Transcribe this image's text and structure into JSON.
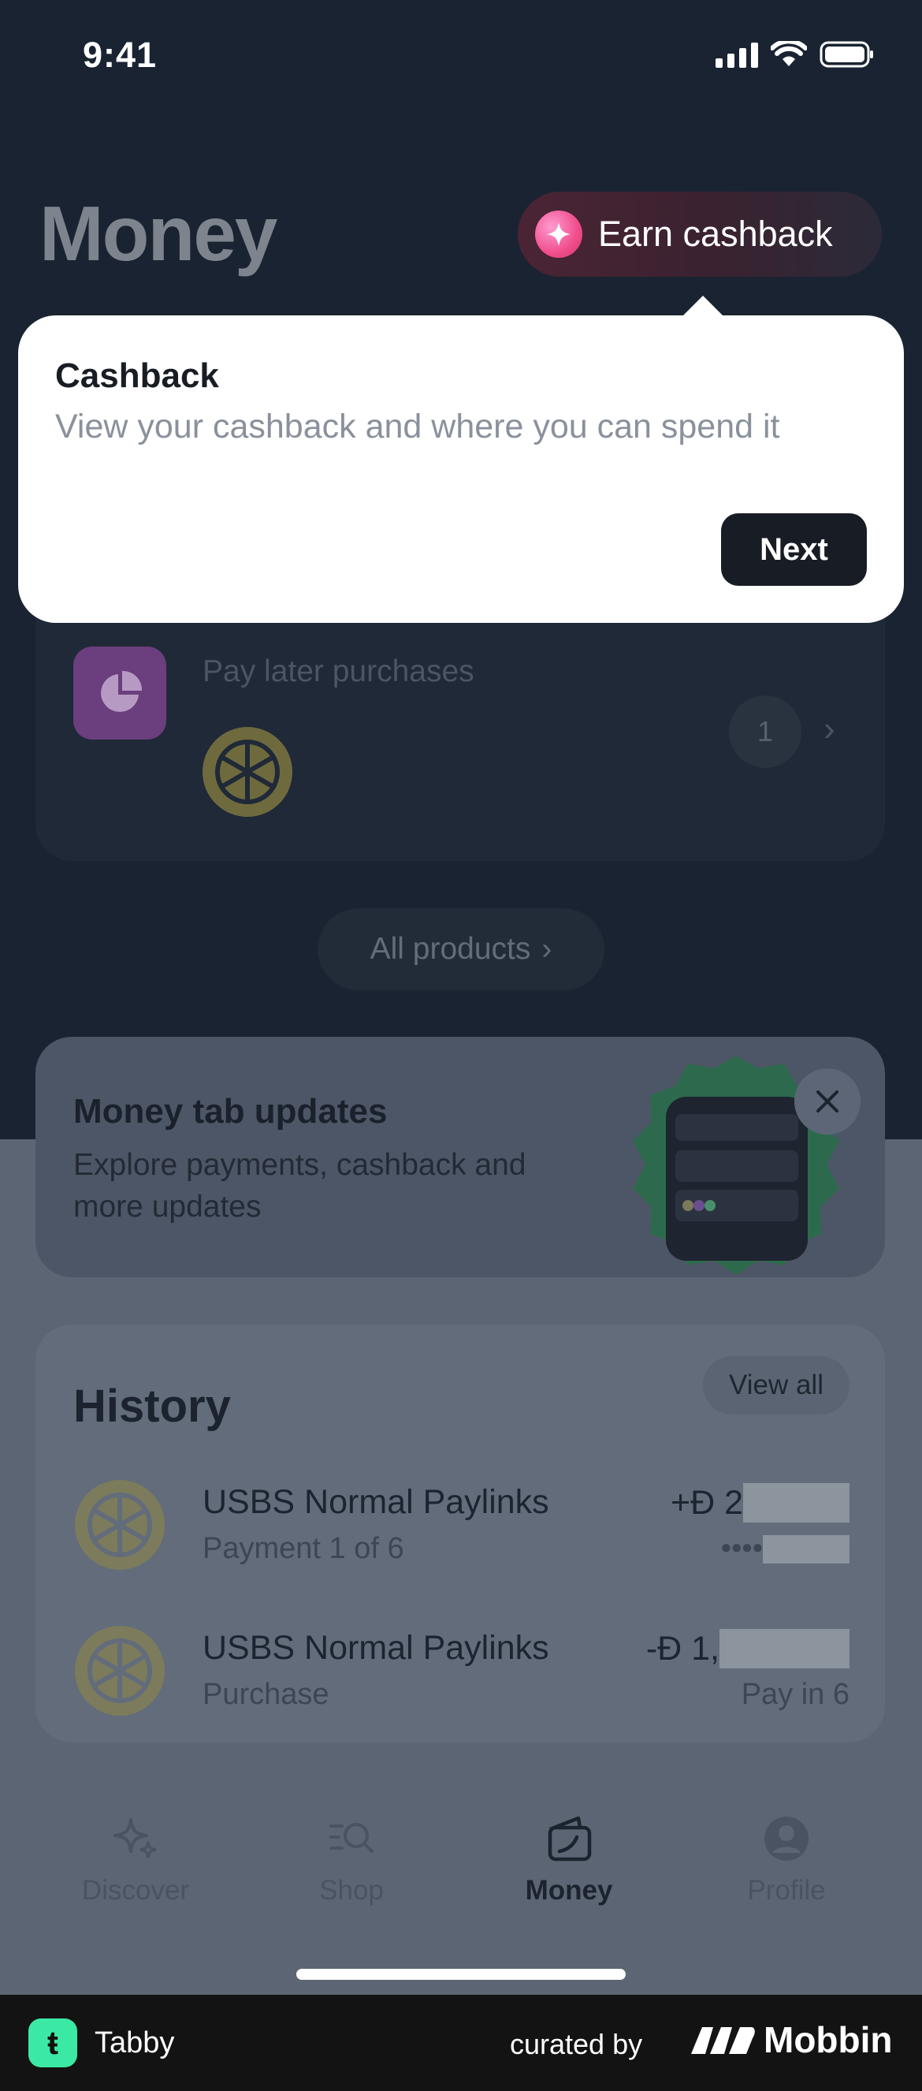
{
  "status_bar": {
    "time": "9:41"
  },
  "header": {
    "title": "Money",
    "earn_button": "Earn cashback"
  },
  "tooltip": {
    "title": "Cashback",
    "body": "View your cashback and where you can spend it",
    "next_label": "Next"
  },
  "paylater": {
    "label": "Pay later purchases",
    "count": "1"
  },
  "all_products": "All products",
  "updates": {
    "title": "Money tab updates",
    "body": "Explore payments, cashback and more updates"
  },
  "history": {
    "title": "History",
    "view_all": "View all",
    "rows": [
      {
        "name": "USBS Normal Paylinks",
        "sub": "Payment 1 of 6",
        "amount": "+Đ 2",
        "right_sub": "••••"
      },
      {
        "name": "USBS Normal Paylinks",
        "sub": "Purchase",
        "amount": "-Đ 1,",
        "right_sub": "Pay in 6"
      }
    ]
  },
  "tabbar": {
    "tabs": [
      {
        "label": "Discover",
        "icon": "sparkles-icon"
      },
      {
        "label": "Shop",
        "icon": "search-list-icon"
      },
      {
        "label": "Money",
        "icon": "wallet-icon",
        "active": true
      },
      {
        "label": "Profile",
        "icon": "profile-icon"
      }
    ]
  },
  "footer": {
    "app_name": "Tabby",
    "curated_by": "curated by",
    "brand": "Mobbin"
  },
  "colors": {
    "accent_pink": "#f04e8c",
    "tabby_green": "#3ce9a4",
    "paylater_purple": "#6b3e7e"
  }
}
